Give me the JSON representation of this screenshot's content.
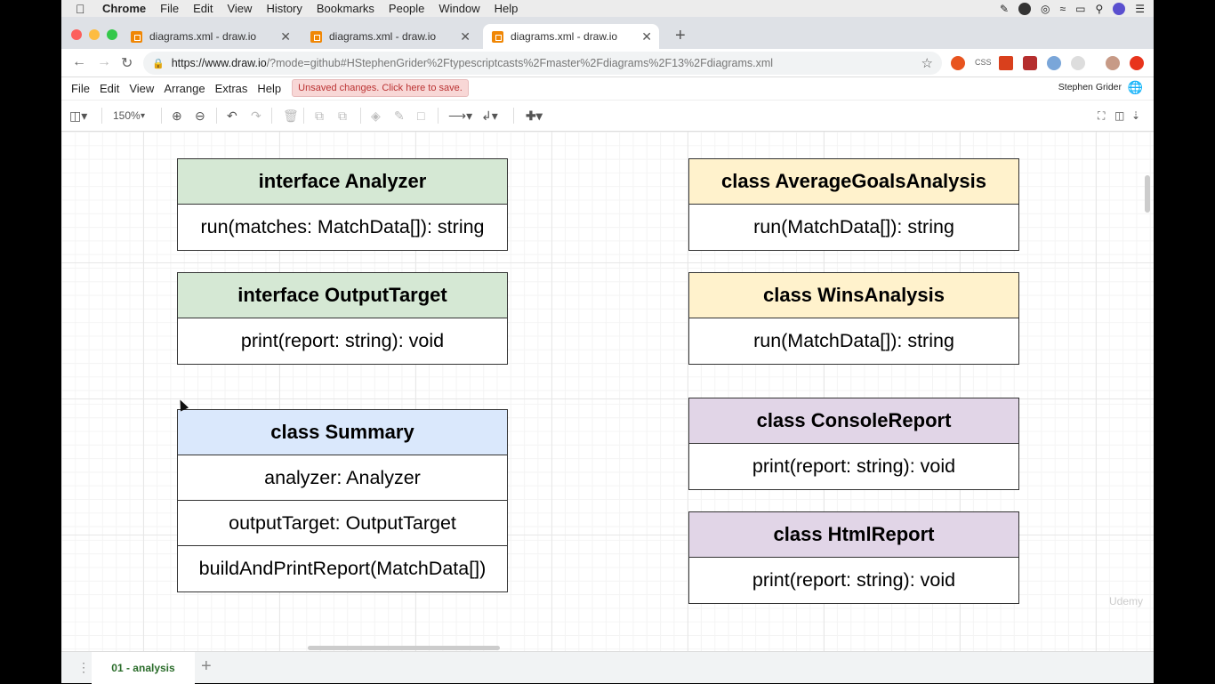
{
  "mac_menu": {
    "app": "Chrome",
    "items": [
      "File",
      "Edit",
      "View",
      "History",
      "Bookmarks",
      "People",
      "Window",
      "Help"
    ]
  },
  "tabs": [
    {
      "title": "diagrams.xml - draw.io"
    },
    {
      "title": "diagrams.xml - draw.io"
    },
    {
      "title": "diagrams.xml - draw.io"
    }
  ],
  "address": {
    "url_host": "https://www.draw.io",
    "url_rest": "/?mode=github#HStephenGrider%2Ftypescriptcasts%2Fmaster%2Fdiagrams%2F13%2Fdiagrams.xml"
  },
  "app_menu": {
    "items": [
      "File",
      "Edit",
      "View",
      "Arrange",
      "Extras",
      "Help"
    ],
    "unsaved": "Unsaved changes. Click here to save.",
    "user": "Stephen Grider"
  },
  "toolbar": {
    "zoom": "150%"
  },
  "diagram": {
    "analyzer": {
      "title": "interface Analyzer",
      "rows": [
        "run(matches: MatchData[]): string"
      ]
    },
    "output_target": {
      "title": "interface OutputTarget",
      "rows": [
        "print(report: string): void"
      ]
    },
    "summary": {
      "title": "class Summary",
      "rows": [
        "analyzer: Analyzer",
        "outputTarget: OutputTarget",
        "buildAndPrintReport(MatchData[])"
      ]
    },
    "average_goals": {
      "title": "class AverageGoalsAnalysis",
      "rows": [
        "run(MatchData[]): string"
      ]
    },
    "wins": {
      "title": "class WinsAnalysis",
      "rows": [
        "run(MatchData[]): string"
      ]
    },
    "console_report": {
      "title": "class ConsoleReport",
      "rows": [
        "print(report: string): void"
      ]
    },
    "html_report": {
      "title": "class HtmlReport",
      "rows": [
        "print(report: string): void"
      ]
    }
  },
  "watermark": "Udemy",
  "footer": {
    "page_tab": "01 - analysis"
  }
}
